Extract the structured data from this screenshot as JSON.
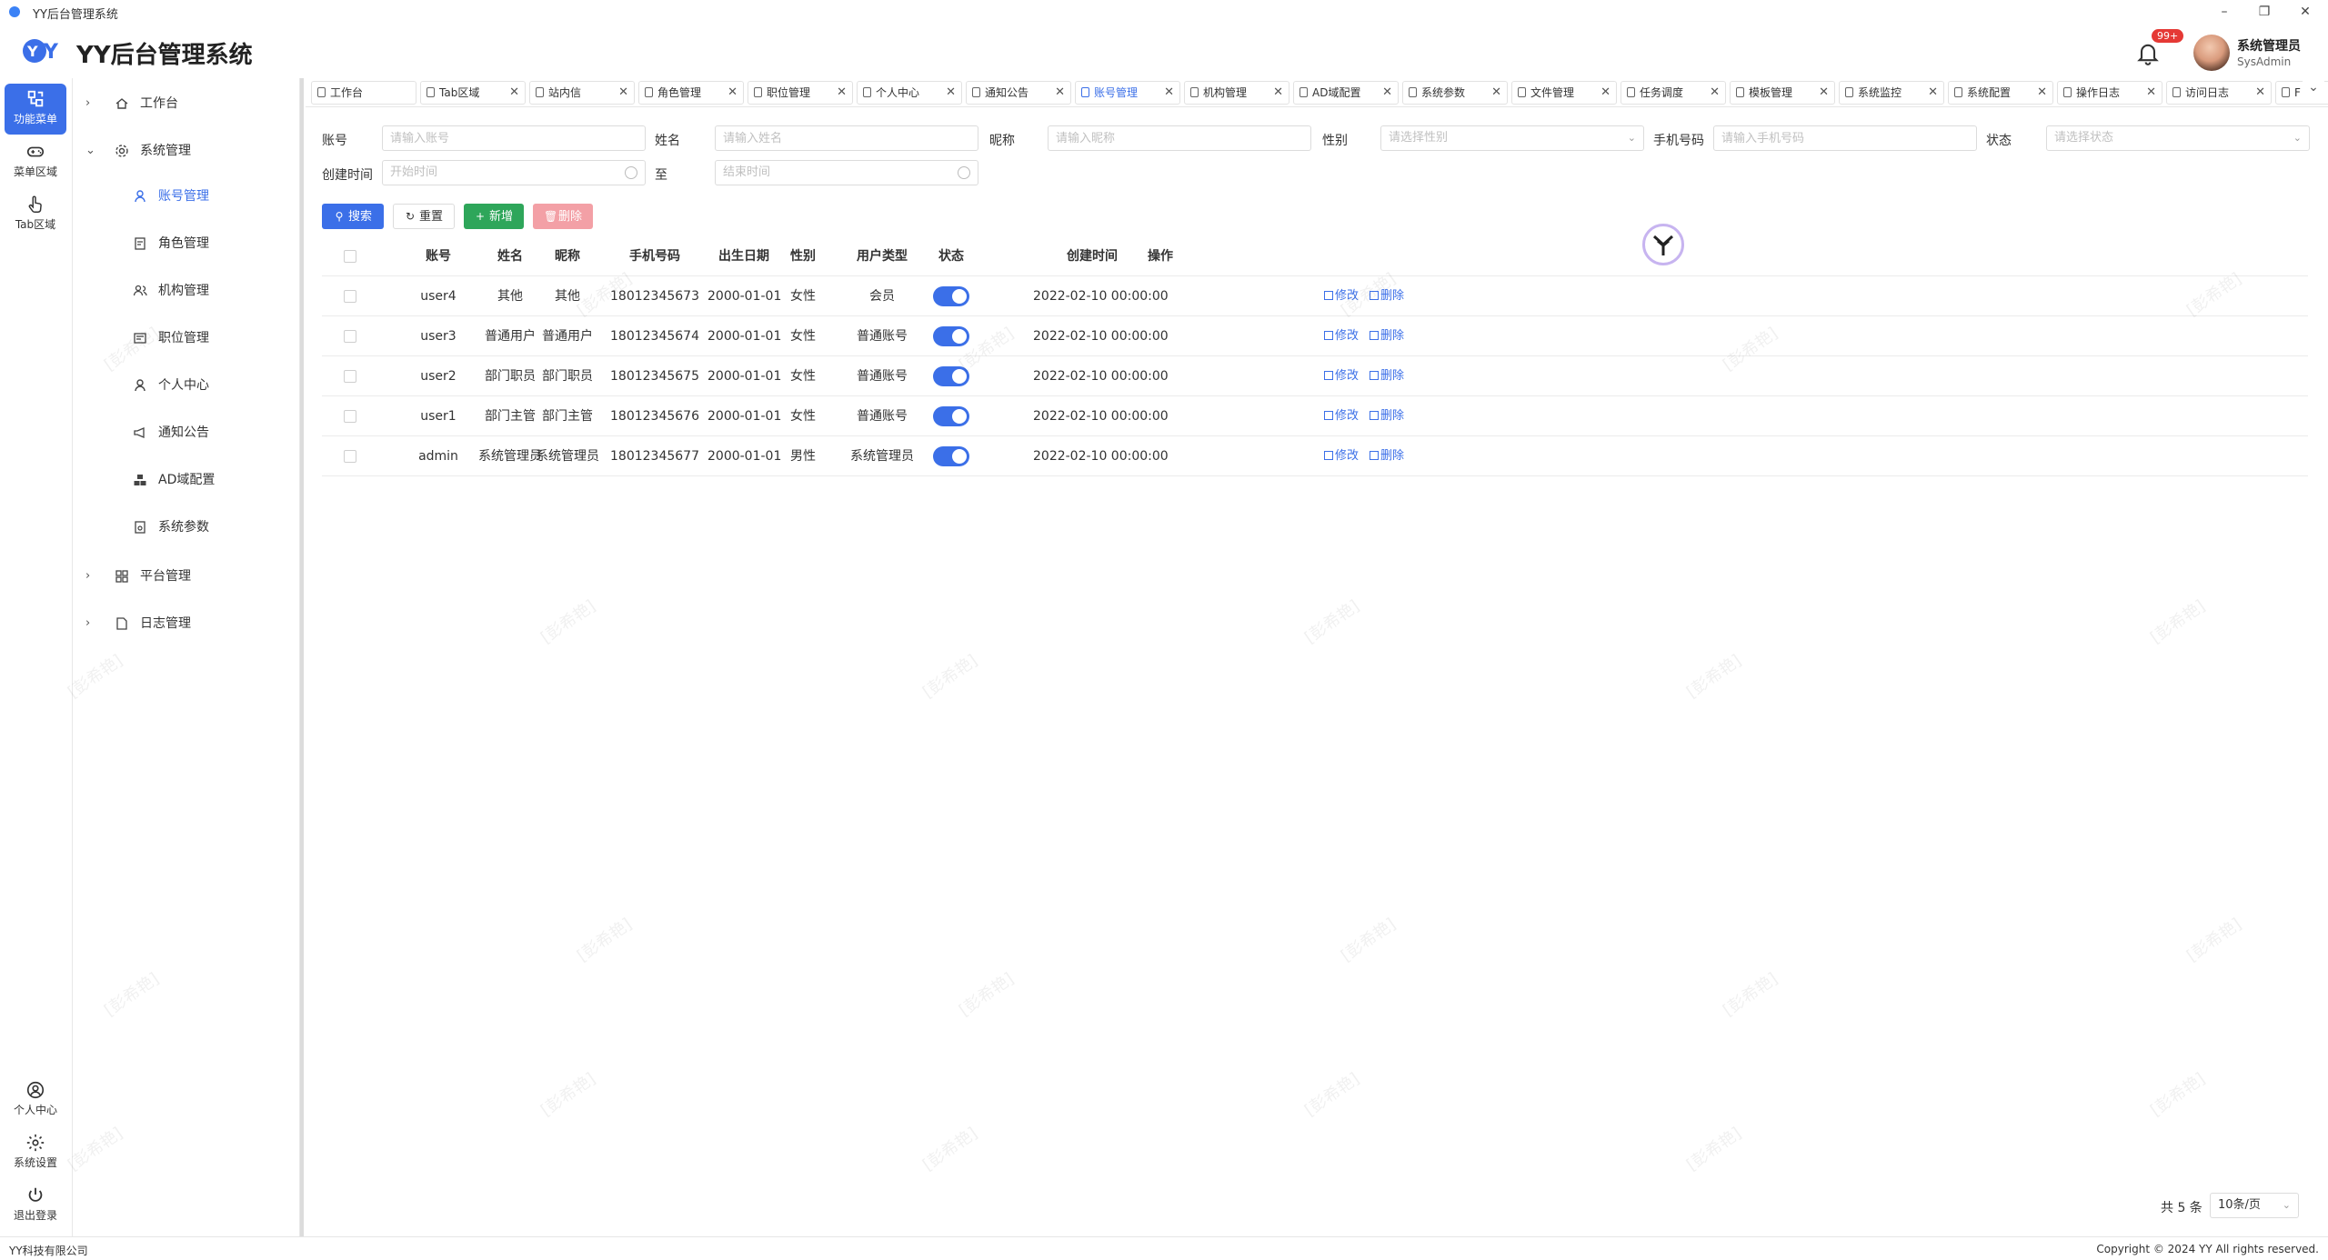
{
  "window": {
    "title": "YY后台管理系统",
    "minimize": "–",
    "restore": "❐",
    "close": "✕"
  },
  "header": {
    "app_name": "YY后台管理系统",
    "badge": "99+",
    "user_name": "系统管理员",
    "user_role": "SysAdmin"
  },
  "rail": {
    "top": [
      {
        "label": "功能菜单",
        "icon": "menu-grid-icon",
        "active": true
      },
      {
        "label": "菜单区域",
        "icon": "gamepad-icon"
      },
      {
        "label": "Tab区域",
        "icon": "hand-pointer-icon"
      }
    ],
    "bottom": [
      {
        "label": "个人中心",
        "icon": "user-circle-icon"
      },
      {
        "label": "系统设置",
        "icon": "gear-icon"
      },
      {
        "label": "退出登录",
        "icon": "power-icon"
      }
    ]
  },
  "menu": {
    "workbench": "工作台",
    "system": "系统管理",
    "system_items": [
      "账号管理",
      "角色管理",
      "机构管理",
      "职位管理",
      "个人中心",
      "通知公告",
      "AD域配置",
      "系统参数"
    ],
    "platform": "平台管理",
    "logs": "日志管理"
  },
  "tabs": [
    {
      "label": "工作台",
      "closable": false
    },
    {
      "label": "Tab区域"
    },
    {
      "label": "站内信"
    },
    {
      "label": "角色管理"
    },
    {
      "label": "职位管理"
    },
    {
      "label": "个人中心"
    },
    {
      "label": "通知公告"
    },
    {
      "label": "账号管理",
      "active": true
    },
    {
      "label": "机构管理"
    },
    {
      "label": "AD域配置"
    },
    {
      "label": "系统参数"
    },
    {
      "label": "文件管理"
    },
    {
      "label": "任务调度"
    },
    {
      "label": "模板管理"
    },
    {
      "label": "系统监控"
    },
    {
      "label": "系统配置"
    },
    {
      "label": "操作日志"
    },
    {
      "label": "访问日志"
    },
    {
      "label": "F"
    }
  ],
  "filters": {
    "account": {
      "label": "账号",
      "placeholder": "请输入账号"
    },
    "name": {
      "label": "姓名",
      "placeholder": "请输入姓名"
    },
    "nickname": {
      "label": "昵称",
      "placeholder": "请输入昵称"
    },
    "gender": {
      "label": "性别",
      "placeholder": "请选择性别"
    },
    "phone": {
      "label": "手机号码",
      "placeholder": "请输入手机号码"
    },
    "status": {
      "label": "状态",
      "placeholder": "请选择状态"
    },
    "created": {
      "label": "创建时间",
      "start_placeholder": "开始时间",
      "to": "至",
      "end_placeholder": "结束时间"
    }
  },
  "buttons": {
    "search": "搜索",
    "reset": "重置",
    "add": "新增",
    "delete": "删除"
  },
  "table": {
    "columns": [
      "账号",
      "姓名",
      "昵称",
      "手机号码",
      "出生日期",
      "性别",
      "用户类型",
      "状态",
      "创建时间",
      "操作"
    ],
    "edit_label": "修改",
    "delete_label": "删除",
    "rows": [
      {
        "account": "user4",
        "name": "其他",
        "nickname": "其他",
        "phone": "18012345673",
        "birth": "2000-01-01",
        "gender": "女性",
        "type": "会员",
        "enabled": true,
        "created": "2022-02-10 00:00:00"
      },
      {
        "account": "user3",
        "name": "普通用户",
        "nickname": "普通用户",
        "phone": "18012345674",
        "birth": "2000-01-01",
        "gender": "女性",
        "type": "普通账号",
        "enabled": true,
        "created": "2022-02-10 00:00:00"
      },
      {
        "account": "user2",
        "name": "部门职员",
        "nickname": "部门职员",
        "phone": "18012345675",
        "birth": "2000-01-01",
        "gender": "女性",
        "type": "普通账号",
        "enabled": true,
        "created": "2022-02-10 00:00:00"
      },
      {
        "account": "user1",
        "name": "部门主管",
        "nickname": "部门主管",
        "phone": "18012345676",
        "birth": "2000-01-01",
        "gender": "女性",
        "type": "普通账号",
        "enabled": true,
        "created": "2022-02-10 00:00:00"
      },
      {
        "account": "admin",
        "name": "系统管理员",
        "nickname": "系统管理员",
        "phone": "18012345677",
        "birth": "2000-01-01",
        "gender": "男性",
        "type": "系统管理员",
        "enabled": true,
        "created": "2022-02-10 00:00:00"
      }
    ]
  },
  "pagination": {
    "total": "共 5 条",
    "page_size": "10条/页"
  },
  "watermark": "[彭希艳]",
  "footer": {
    "company": "YY科技有限公司",
    "copyright": "Copyright © 2024 YY All rights reserved."
  },
  "colors": {
    "primary": "#3b6fe8",
    "success": "#2ea65a",
    "danger": "#f3a0a6",
    "badge": "#e53935"
  }
}
